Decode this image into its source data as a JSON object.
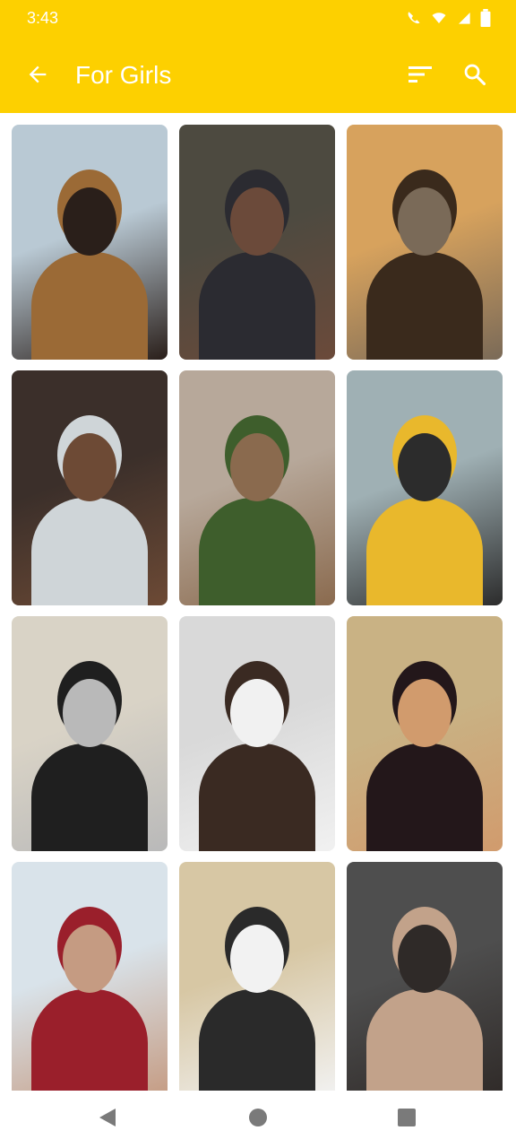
{
  "status_bar": {
    "time": "3:43"
  },
  "app_bar": {
    "title": "For Girls",
    "background": "#FDD000"
  },
  "icons": {
    "back": "arrow-back-icon",
    "sort": "sort-icon",
    "search": "search-icon",
    "nav_back": "triangle-back-icon",
    "nav_home": "circle-home-icon",
    "nav_recents": "square-recents-icon"
  },
  "grid": {
    "columns": 3,
    "items": [
      {
        "palette": [
          "#b9c9d4",
          "#9b6a36",
          "#2a1f1a"
        ]
      },
      {
        "palette": [
          "#4d4a40",
          "#2b2b31",
          "#6b4a3a"
        ]
      },
      {
        "palette": [
          "#d7a25d",
          "#3a2a1c",
          "#7a6a58"
        ]
      },
      {
        "palette": [
          "#3b2f2a",
          "#cfd5d8",
          "#6d4a35"
        ]
      },
      {
        "palette": [
          "#b7a89a",
          "#3e5e2c",
          "#8a6a4e"
        ]
      },
      {
        "palette": [
          "#9fb0b4",
          "#e9b82c",
          "#2c2c2c"
        ]
      },
      {
        "palette": [
          "#d9d3c6",
          "#1f1f1f",
          "#b9b9b9"
        ]
      },
      {
        "palette": [
          "#d9d9d9",
          "#3a2a22",
          "#f1f1f1"
        ]
      },
      {
        "palette": [
          "#c9b284",
          "#23171a",
          "#d19b6d"
        ]
      },
      {
        "palette": [
          "#d9e3ea",
          "#9a1f2b",
          "#c59b82"
        ]
      },
      {
        "palette": [
          "#d7c7a4",
          "#2a2a2a",
          "#f2f2f2"
        ]
      },
      {
        "palette": [
          "#4e4e4e",
          "#c2a28a",
          "#2f2a28"
        ]
      }
    ]
  }
}
